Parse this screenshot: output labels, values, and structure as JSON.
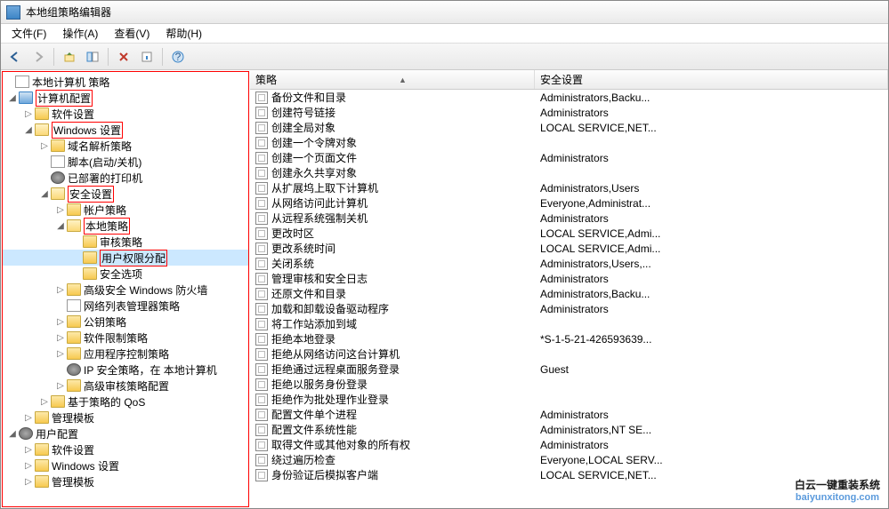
{
  "window": {
    "title": "本地组策略编辑器"
  },
  "menu": {
    "file": "文件(F)",
    "action": "操作(A)",
    "view": "查看(V)",
    "help": "帮助(H)"
  },
  "tree": {
    "root": "本地计算机 策略",
    "cc": "计算机配置",
    "cc_soft": "软件设置",
    "cc_win": "Windows 设置",
    "dns": "域名解析策略",
    "script": "脚本(启动/关机)",
    "printer": "已部署的打印机",
    "sec": "安全设置",
    "acct": "帐户策略",
    "local": "本地策略",
    "audit": "审核策略",
    "rights": "用户权限分配",
    "opts": "安全选项",
    "firewall": "高级安全 Windows 防火墙",
    "netlist": "网络列表管理器策略",
    "pubkey": "公钥策略",
    "softrestrict": "软件限制策略",
    "appctrl": "应用程序控制策略",
    "ipsec": "IP 安全策略，在 本地计算机",
    "advaudit": "高级审核策略配置",
    "qos": "基于策略的 QoS",
    "admtmpl": "管理模板",
    "uc": "用户配置",
    "uc_soft": "软件设置",
    "uc_win": "Windows 设置",
    "uc_admtmpl": "管理模板"
  },
  "list": {
    "hdr": {
      "policy": "策略",
      "security": "安全设置"
    },
    "rows": [
      {
        "p": "备份文件和目录",
        "s": "Administrators,Backu..."
      },
      {
        "p": "创建符号链接",
        "s": "Administrators"
      },
      {
        "p": "创建全局对象",
        "s": "LOCAL SERVICE,NET..."
      },
      {
        "p": "创建一个令牌对象",
        "s": ""
      },
      {
        "p": "创建一个页面文件",
        "s": "Administrators"
      },
      {
        "p": "创建永久共享对象",
        "s": ""
      },
      {
        "p": "从扩展坞上取下计算机",
        "s": "Administrators,Users"
      },
      {
        "p": "从网络访问此计算机",
        "s": "Everyone,Administrat..."
      },
      {
        "p": "从远程系统强制关机",
        "s": "Administrators"
      },
      {
        "p": "更改时区",
        "s": "LOCAL SERVICE,Admi..."
      },
      {
        "p": "更改系统时间",
        "s": "LOCAL SERVICE,Admi..."
      },
      {
        "p": "关闭系统",
        "s": "Administrators,Users,..."
      },
      {
        "p": "管理审核和安全日志",
        "s": "Administrators"
      },
      {
        "p": "还原文件和目录",
        "s": "Administrators,Backu..."
      },
      {
        "p": "加载和卸载设备驱动程序",
        "s": "Administrators"
      },
      {
        "p": "将工作站添加到域",
        "s": ""
      },
      {
        "p": "拒绝本地登录",
        "s": "*S-1-5-21-426593639..."
      },
      {
        "p": "拒绝从网络访问这台计算机",
        "s": ""
      },
      {
        "p": "拒绝通过远程桌面服务登录",
        "s": "Guest"
      },
      {
        "p": "拒绝以服务身份登录",
        "s": ""
      },
      {
        "p": "拒绝作为批处理作业登录",
        "s": ""
      },
      {
        "p": "配置文件单个进程",
        "s": "Administrators"
      },
      {
        "p": "配置文件系统性能",
        "s": "Administrators,NT SE..."
      },
      {
        "p": "取得文件或其他对象的所有权",
        "s": "Administrators"
      },
      {
        "p": "绕过遍历检查",
        "s": "Everyone,LOCAL SERV..."
      },
      {
        "p": "身份验证后模拟客户端",
        "s": "LOCAL SERVICE,NET..."
      }
    ]
  },
  "watermark": {
    "cn": "白云一键重装系统",
    "en": "baiyunxitong.com"
  }
}
